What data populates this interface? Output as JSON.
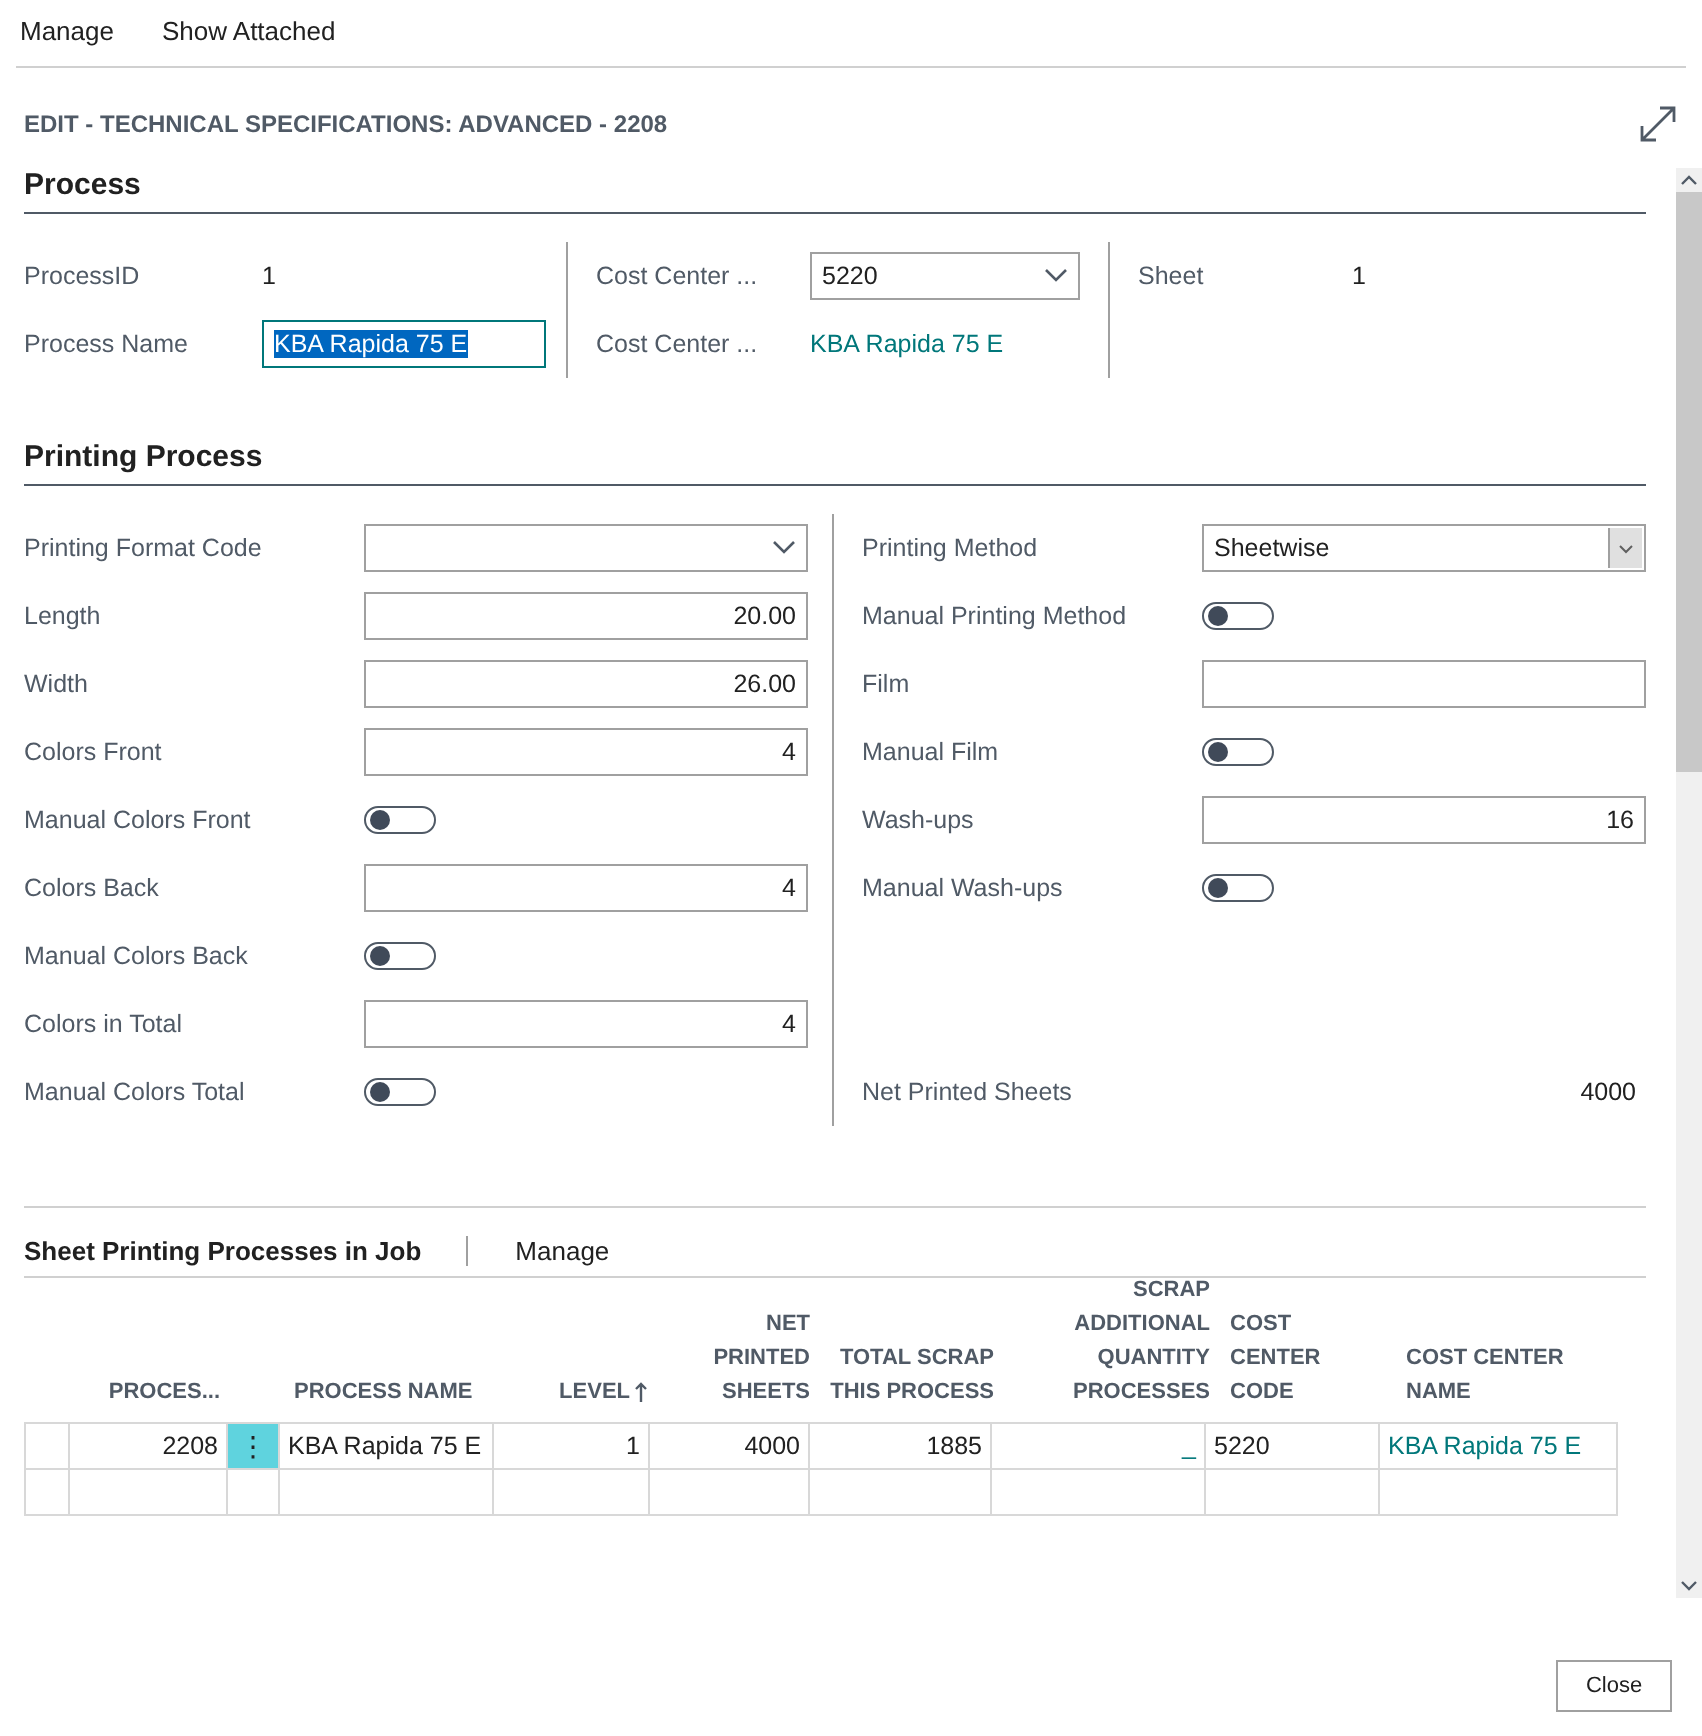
{
  "action_bar": {
    "items": [
      "Manage",
      "Show Attached"
    ]
  },
  "dialog": {
    "title": "EDIT - TECHNICAL SPECIFICATIONS: ADVANCED - 2208"
  },
  "process": {
    "heading": "Process",
    "columns": [
      [
        {
          "kind": "readonly",
          "label": "ProcessID",
          "value": "1"
        },
        {
          "kind": "text",
          "label": "Process Name",
          "value": "KBA Rapida 75 E",
          "selected": true
        }
      ],
      [
        {
          "kind": "select",
          "label": "Cost Center ...",
          "value": "5220"
        },
        {
          "kind": "link",
          "label": "Cost Center ...",
          "value": "KBA Rapida 75 E"
        }
      ],
      [
        {
          "kind": "readonly",
          "label": "Sheet",
          "value": "1"
        }
      ]
    ]
  },
  "printing_process": {
    "heading": "Printing Process",
    "columns": [
      [
        {
          "kind": "select",
          "label": "Printing Format Code"
        },
        {
          "kind": "number",
          "label": "Length",
          "value": "20.00"
        },
        {
          "kind": "number",
          "label": "Width",
          "value": "26.00"
        },
        {
          "kind": "number",
          "label": "Colors Front",
          "value": "4"
        },
        {
          "kind": "toggle",
          "label": "Manual Colors Front",
          "checked": false
        },
        {
          "kind": "number",
          "label": "Colors Back",
          "value": "4"
        },
        {
          "kind": "toggle",
          "label": "Manual Colors Back",
          "checked": false
        },
        {
          "kind": "number",
          "label": "Colors in Total",
          "value": "4"
        },
        {
          "kind": "toggle",
          "label": "Manual Colors Total",
          "checked": false
        }
      ],
      [
        {
          "kind": "dropdown",
          "label": "Printing Method",
          "value": "Sheetwise"
        },
        {
          "kind": "toggle",
          "label": "Manual Printing Method",
          "checked": false
        },
        {
          "kind": "text",
          "label": "Film"
        },
        {
          "kind": "toggle",
          "label": "Manual Film",
          "checked": false
        },
        {
          "kind": "number",
          "label": "Wash-ups",
          "value": "16"
        },
        {
          "kind": "toggle",
          "label": "Manual Wash-ups",
          "checked": false
        },
        {
          "kind": "spacer"
        },
        {
          "kind": "spacer"
        },
        {
          "kind": "total",
          "label": "Net Printed Sheets",
          "value": "4000"
        }
      ]
    ]
  },
  "subpage": {
    "heading": "Sheet Printing Processes in Job",
    "actions": [
      "Manage"
    ],
    "columns": [
      {
        "label": "PROCES...",
        "kind": "number",
        "sorted": false
      },
      {
        "label": "PROCESS NAME",
        "kind": "text",
        "sorted": false
      },
      {
        "label": "LEVEL",
        "kind": "number",
        "sorted": true
      },
      {
        "label": "NET PRINTED SHEETS",
        "kind": "number",
        "sorted": false
      },
      {
        "label": "TOTAL SCRAP THIS PROCESS",
        "kind": "number",
        "sorted": false
      },
      {
        "label": "SCRAP ADDITIONAL QUANTITY PROCESSES",
        "kind": "number",
        "sorted": false
      },
      {
        "label": "COST CENTER CODE",
        "kind": "text",
        "sorted": false
      },
      {
        "label": "COST CENTER NAME",
        "kind": "link",
        "sorted": false
      }
    ],
    "rows": [
      {
        "selected": true,
        "menu": "⋮",
        "cells": [
          "2208",
          "KBA Rapida 75 E",
          "1",
          "4000",
          "1885",
          "_",
          "5220",
          "KBA Rapida 75 E"
        ]
      }
    ]
  },
  "buttons": [
    "Close"
  ]
}
